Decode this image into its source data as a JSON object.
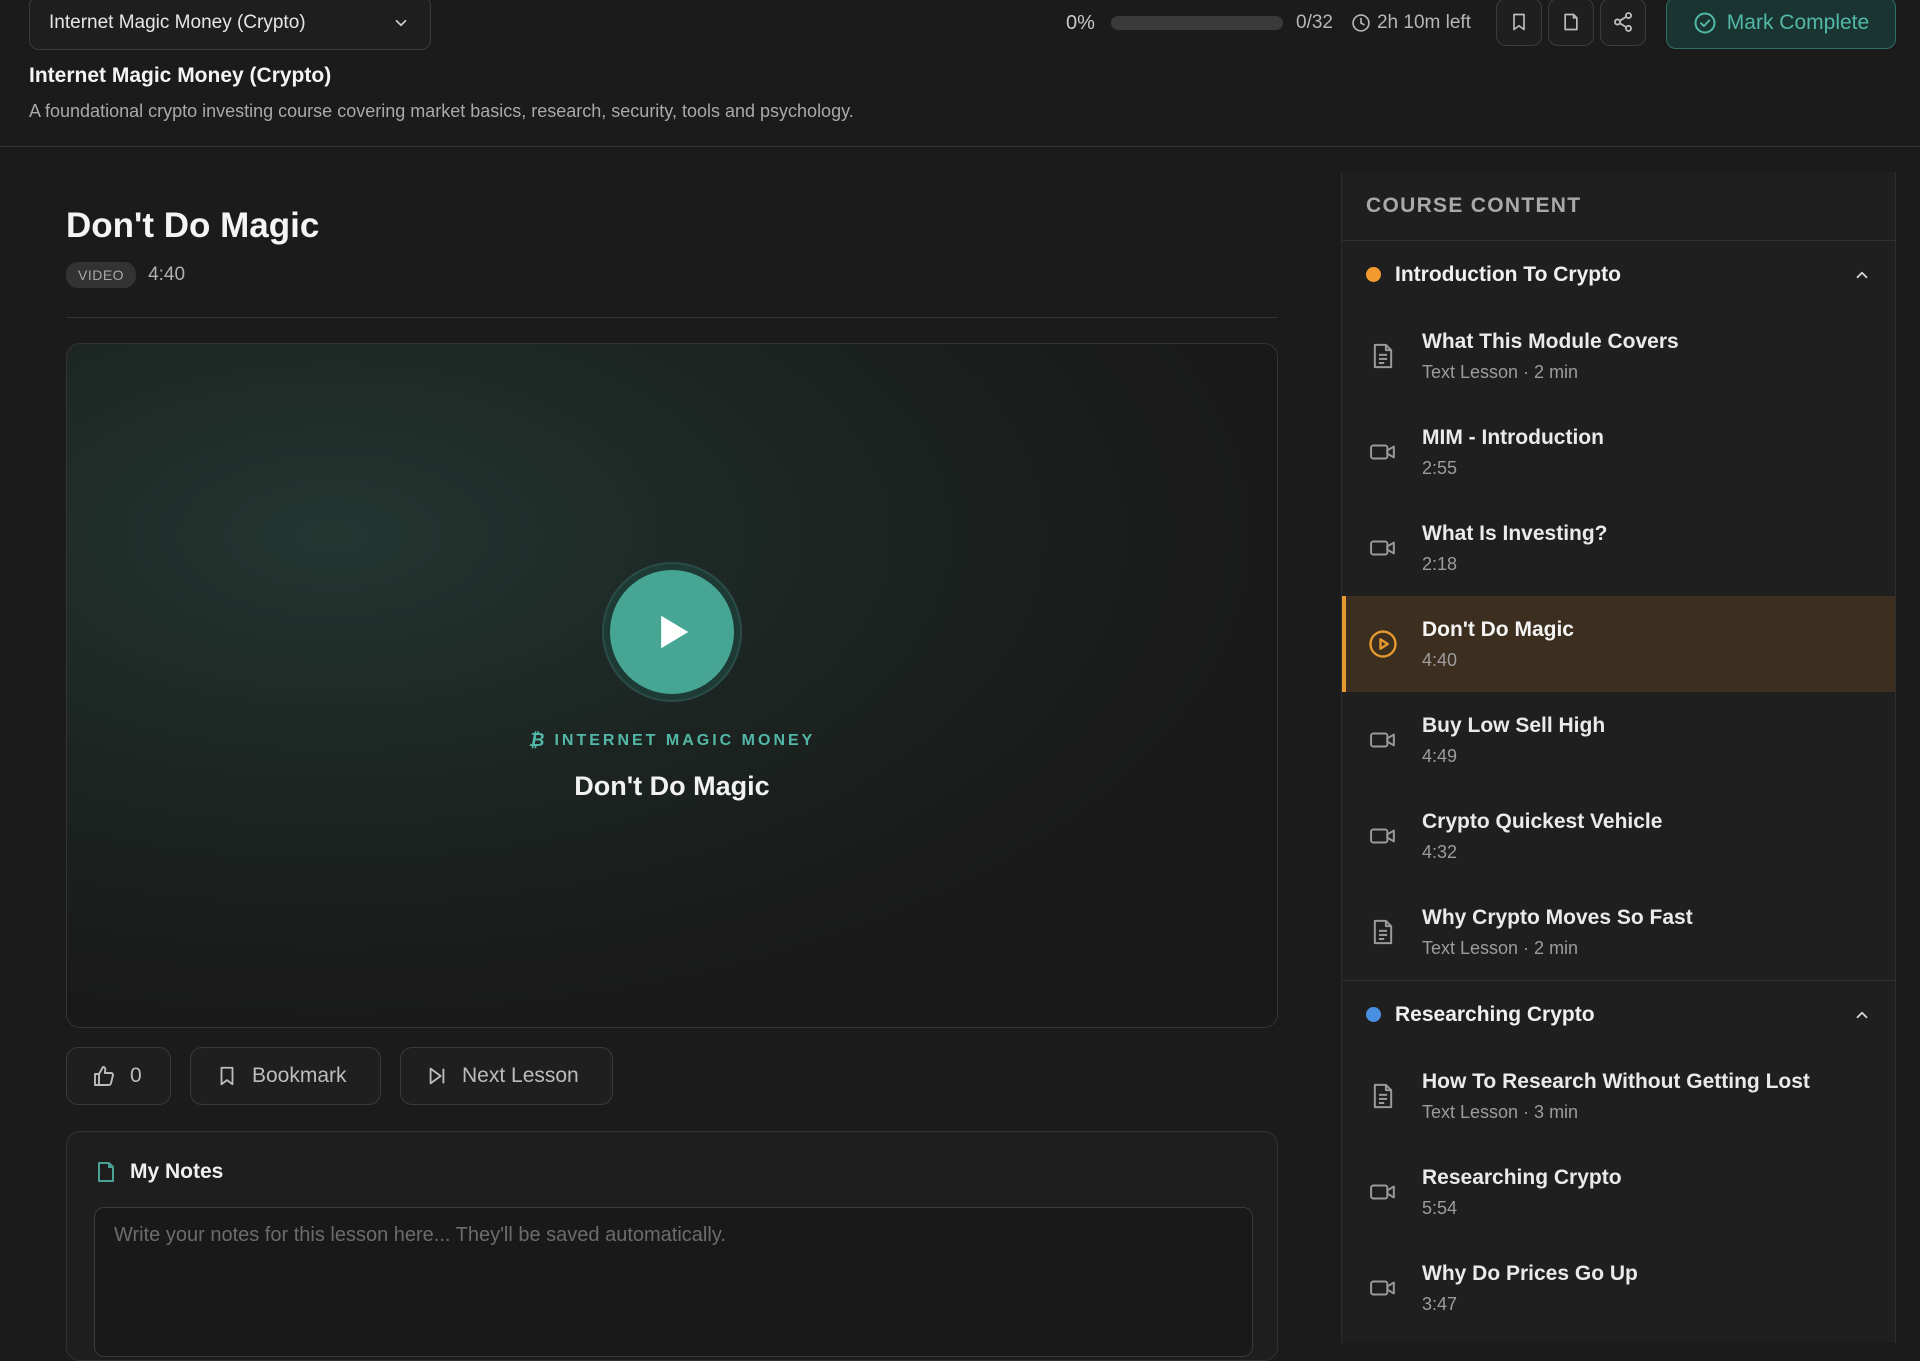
{
  "header": {
    "selector_value": "Internet Magic Money (Crypto)",
    "course_title": "Internet Magic Money (Crypto)",
    "course_description": "A foundational crypto investing course covering market basics, research, security, tools and psychology.",
    "progress_percent_label": "0%",
    "progress_fraction": 0,
    "progress_count": "0/32",
    "time_left": "2h 10m left",
    "mark_complete_label": "Mark Complete"
  },
  "lesson": {
    "title": "Don't Do Magic",
    "type_badge": "VIDEO",
    "duration": "4:40"
  },
  "video": {
    "brand_label": "INTERNET MAGIC MONEY",
    "title": "Don't Do Magic"
  },
  "actions": {
    "like_count": "0",
    "bookmark_label": "Bookmark",
    "next_label": "Next Lesson"
  },
  "notes": {
    "heading": "My Notes",
    "placeholder": "Write your notes for this lesson here... They'll be saved automatically."
  },
  "sidebar": {
    "heading": "COURSE CONTENT",
    "modules": [
      {
        "title": "Introduction To Crypto",
        "dot_color": "#f29a2e",
        "lessons": [
          {
            "name": "What This Module Covers",
            "sub": "Text Lesson · 2 min",
            "icon": "document-icon"
          },
          {
            "name": "MIM - Introduction",
            "sub": "2:55",
            "icon": "video-camera-icon"
          },
          {
            "name": "What Is Investing?",
            "sub": "2:18",
            "icon": "video-camera-icon"
          },
          {
            "name": "Don't Do Magic",
            "sub": "4:40",
            "icon": "play-circle-icon",
            "active": true
          },
          {
            "name": "Buy Low Sell High",
            "sub": "4:49",
            "icon": "video-camera-icon"
          },
          {
            "name": "Crypto Quickest Vehicle",
            "sub": "4:32",
            "icon": "video-camera-icon"
          },
          {
            "name": "Why Crypto Moves So Fast",
            "sub": "Text Lesson · 2 min",
            "icon": "document-icon"
          }
        ]
      },
      {
        "title": "Researching Crypto",
        "dot_color": "#4a90e2",
        "lessons": [
          {
            "name": "How To Research Without Getting Lost",
            "sub": "Text Lesson · 3 min",
            "icon": "document-icon"
          },
          {
            "name": "Researching Crypto",
            "sub": "5:54",
            "icon": "video-camera-icon"
          },
          {
            "name": "Why Do Prices Go Up",
            "sub": "3:47",
            "icon": "video-camera-icon"
          }
        ]
      }
    ]
  },
  "colors": {
    "accent_teal": "#4aa396",
    "active_orange": "#e69a2e"
  }
}
